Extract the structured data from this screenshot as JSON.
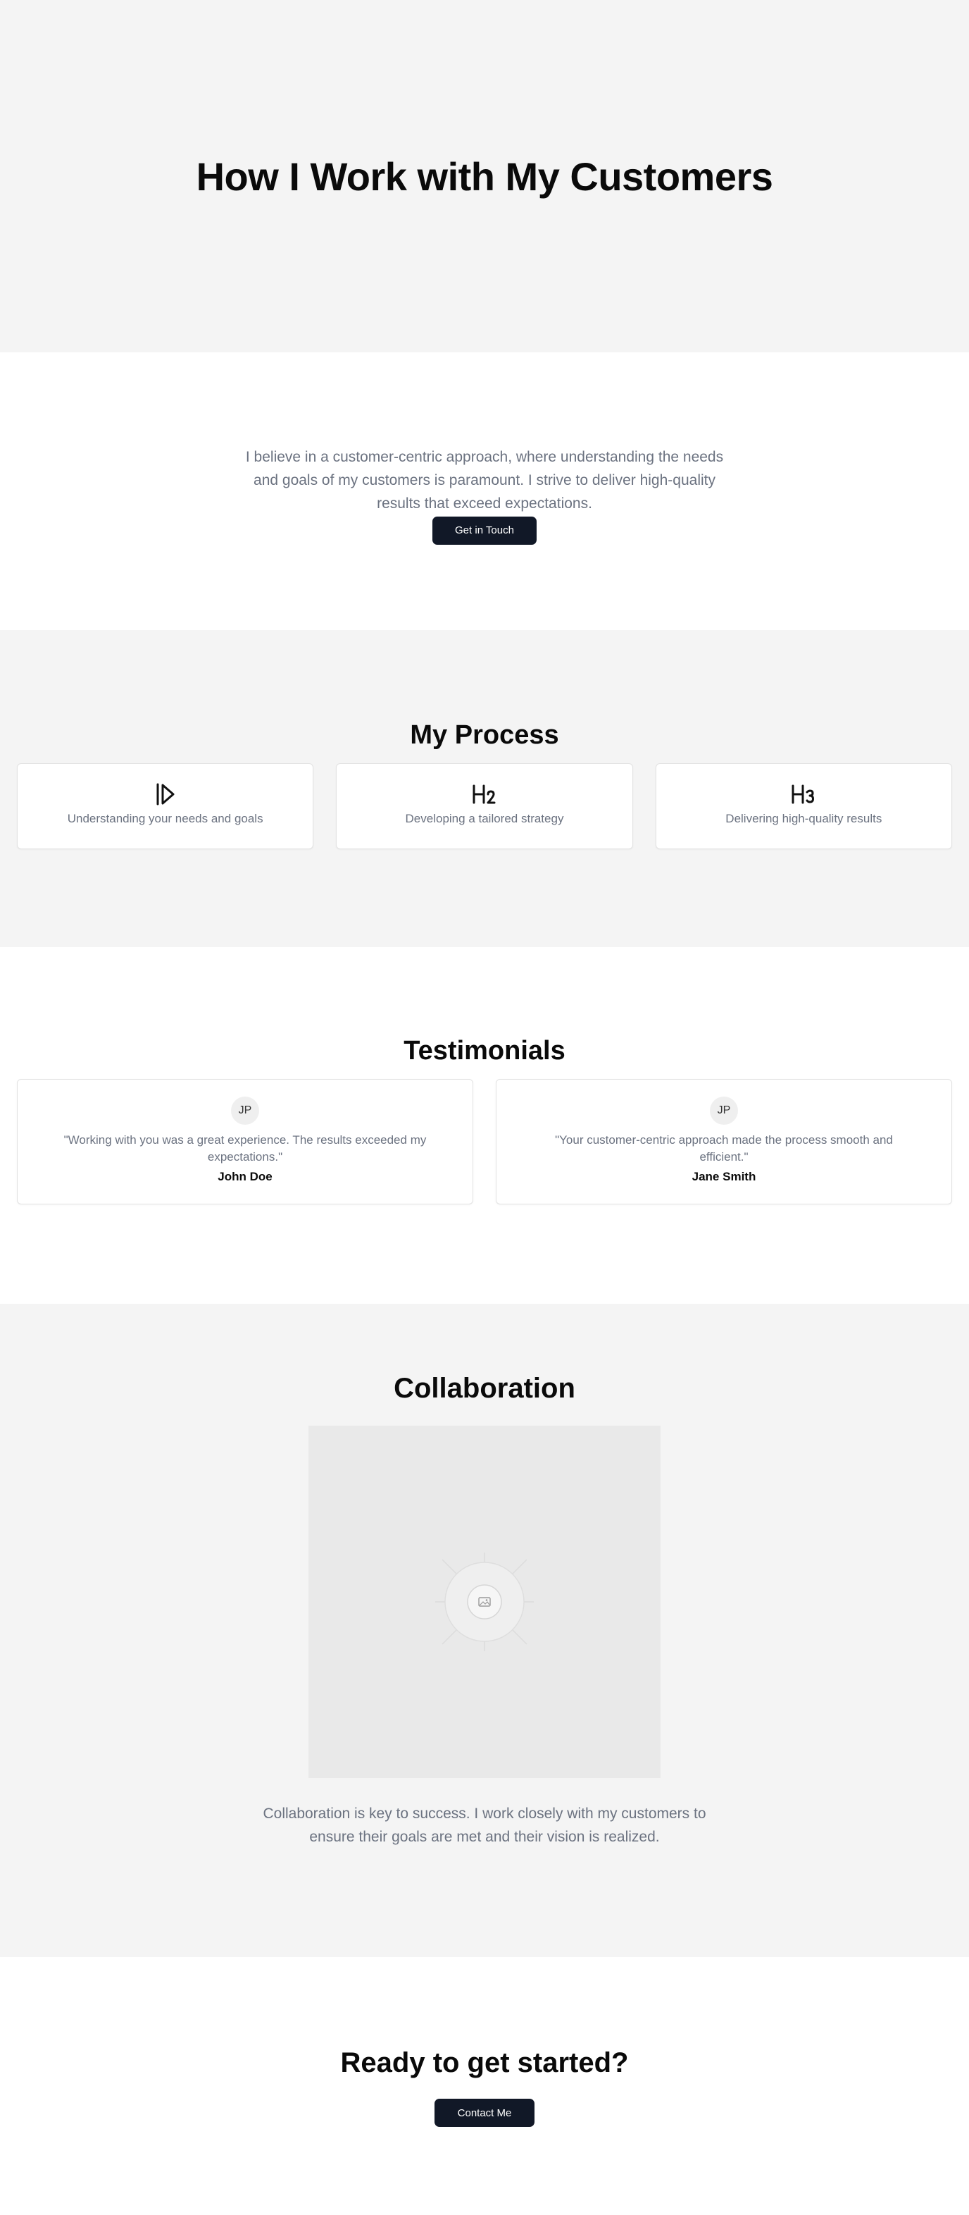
{
  "hero": {
    "title": "How I Work with My Customers"
  },
  "intro": {
    "text": "I believe in a customer-centric approach, where understanding the needs and goals of my customers is paramount. I strive to deliver high-quality results that exceed expectations.",
    "button": "Get in Touch"
  },
  "process": {
    "title": "My Process",
    "steps": [
      {
        "icon": "play-step-icon",
        "label": "Understanding your needs and goals"
      },
      {
        "icon": "heading-2-icon",
        "label": "Developing a tailored strategy"
      },
      {
        "icon": "heading-3-icon",
        "label": "Delivering high-quality results"
      }
    ]
  },
  "testimonials": {
    "title": "Testimonials",
    "items": [
      {
        "initials": "JP",
        "quote": "\"Working with you was a great experience. The results exceeded my expectations.\"",
        "author": "John Doe"
      },
      {
        "initials": "JP",
        "quote": "\"Your customer-centric approach made the process smooth and efficient.\"",
        "author": "Jane Smith"
      }
    ]
  },
  "collaboration": {
    "title": "Collaboration",
    "image_icon": "image-placeholder-icon",
    "text": "Collaboration is key to success. I work closely with my customers to ensure their goals are met and their vision is realized."
  },
  "cta": {
    "title": "Ready to get started?",
    "button": "Contact Me"
  },
  "colors": {
    "button_bg": "#111827",
    "muted_text": "#6b7280",
    "section_gray": "#f4f4f4"
  }
}
